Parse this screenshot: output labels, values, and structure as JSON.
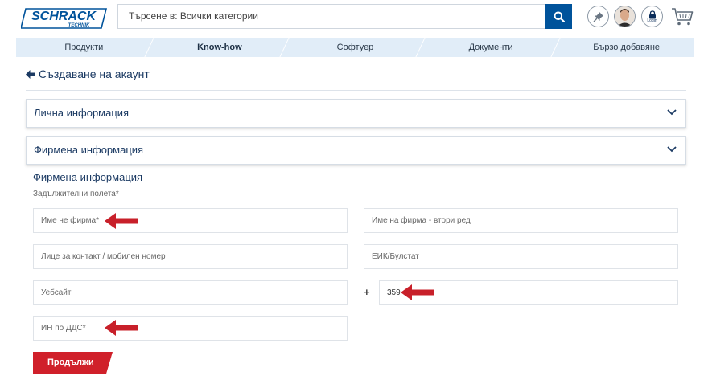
{
  "header": {
    "logo_line1": "SCHRACK",
    "logo_line2": "TECHNIK",
    "search_placeholder": "Търсене в: Всички категории",
    "login_label": "Login"
  },
  "nav": {
    "items": [
      {
        "label": "Продукти"
      },
      {
        "label": "Know-how"
      },
      {
        "label": "Софтуер"
      },
      {
        "label": "Документи"
      },
      {
        "label": "Бързо добавяне"
      }
    ]
  },
  "page": {
    "title": "Създаване на акаунт"
  },
  "accordions": [
    {
      "label": "Лична информация"
    },
    {
      "label": "Фирмена информация"
    }
  ],
  "form": {
    "section_title": "Фирмена информация",
    "required_note": "Задължителни полета*",
    "company_name": "Име не фирма*",
    "company_name_2": "Име на фирма - втори ред",
    "contact_person": "Лице за контакт / мобилен номер",
    "eik": "ЕИК/Булстат",
    "website": "Уебсайт",
    "phone_prefix": "+",
    "phone_code": "359",
    "vat_number": "ИН по ДДС*",
    "continue_label": "Продължи"
  },
  "colors": {
    "brand_blue": "#00539b",
    "nav_bg": "#e1edf8",
    "accent_red": "#d0202a",
    "title_blue": "#1b3a63"
  }
}
